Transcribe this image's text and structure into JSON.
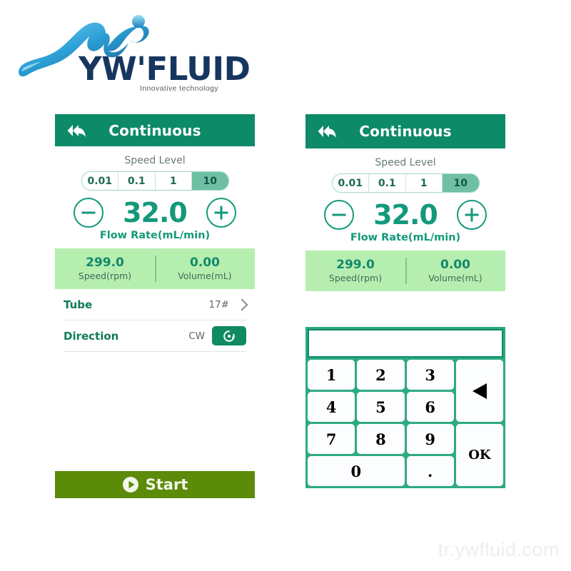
{
  "logo": {
    "wordmark": "YW'FLUID",
    "tagline": "Innovative  technology",
    "wave_icon": "water-wave-icon",
    "droplet_icon": "droplet-icon"
  },
  "watermark": "tr.ywfluid.com",
  "colors": {
    "header_teal": "#0d8a68",
    "accent_green": "#13997a",
    "stats_bg": "#b6eeb0",
    "start_olive": "#5c8a09",
    "keypad_teal": "#2eaa83",
    "segment_active": "#6fc0a3"
  },
  "panel_left": {
    "header": {
      "title": "Continuous",
      "back_icon": "back-arrow-icon"
    },
    "speed_level": {
      "label": "Speed Level",
      "options": [
        "0.01",
        "0.1",
        "1",
        "10"
      ],
      "selected": "10"
    },
    "flow": {
      "minus_icon": "minus-circle-icon",
      "plus_icon": "plus-circle-icon",
      "value": "32.0",
      "caption": "Flow Rate(mL/min)"
    },
    "stats": [
      {
        "value": "299.0",
        "label": "Speed(rpm)"
      },
      {
        "value": "0.00",
        "label": "Volume(mL)"
      }
    ],
    "settings": [
      {
        "label": "Tube",
        "value": "17#",
        "icon": "chevron-right-icon"
      },
      {
        "label": "Direction",
        "value": "CW",
        "icon": "rotate-clockwise-icon"
      }
    ],
    "start": {
      "label": "Start",
      "icon": "play-circle-icon"
    }
  },
  "panel_right": {
    "header": {
      "title": "Continuous",
      "back_icon": "back-arrow-icon"
    },
    "speed_level": {
      "label": "Speed Level",
      "options": [
        "0.01",
        "0.1",
        "1",
        "10"
      ],
      "selected": "10"
    },
    "flow": {
      "minus_icon": "minus-circle-icon",
      "plus_icon": "plus-circle-icon",
      "value": "32.0",
      "caption": "Flow Rate(mL/min)"
    },
    "stats": [
      {
        "value": "299.0",
        "label": "Speed(rpm)"
      },
      {
        "value": "0.00",
        "label": "Volume(mL)"
      }
    ],
    "keypad": {
      "display_value": "",
      "keys": [
        {
          "label": "1",
          "name": "key-1"
        },
        {
          "label": "2",
          "name": "key-2"
        },
        {
          "label": "3",
          "name": "key-3"
        },
        {
          "label": "",
          "name": "key-backspace",
          "icon": "backspace-arrow-icon"
        },
        {
          "label": "4",
          "name": "key-4"
        },
        {
          "label": "5",
          "name": "key-5"
        },
        {
          "label": "6",
          "name": "key-6"
        },
        {
          "label": "7",
          "name": "key-7"
        },
        {
          "label": "8",
          "name": "key-8"
        },
        {
          "label": "9",
          "name": "key-9"
        },
        {
          "label": "OK",
          "name": "key-ok"
        },
        {
          "label": "0",
          "name": "key-0"
        },
        {
          "label": ".",
          "name": "key-decimal"
        }
      ]
    }
  }
}
